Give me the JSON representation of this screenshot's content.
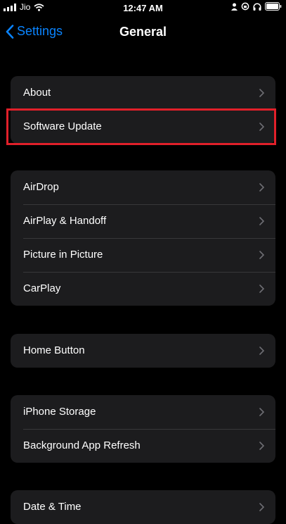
{
  "status_bar": {
    "carrier": "Jio",
    "time": "12:47 AM"
  },
  "nav": {
    "back_label": "Settings",
    "title": "General"
  },
  "groups": [
    {
      "rows": [
        {
          "label": "About"
        },
        {
          "label": "Software Update"
        }
      ]
    },
    {
      "rows": [
        {
          "label": "AirDrop"
        },
        {
          "label": "AirPlay & Handoff"
        },
        {
          "label": "Picture in Picture"
        },
        {
          "label": "CarPlay"
        }
      ]
    },
    {
      "rows": [
        {
          "label": "Home Button"
        }
      ]
    },
    {
      "rows": [
        {
          "label": "iPhone Storage"
        },
        {
          "label": "Background App Refresh"
        }
      ]
    },
    {
      "rows": [
        {
          "label": "Date & Time"
        }
      ]
    }
  ],
  "colors": {
    "accent": "#0a84ff",
    "cell_bg": "#1c1c1e",
    "highlight": "#e1202a"
  }
}
